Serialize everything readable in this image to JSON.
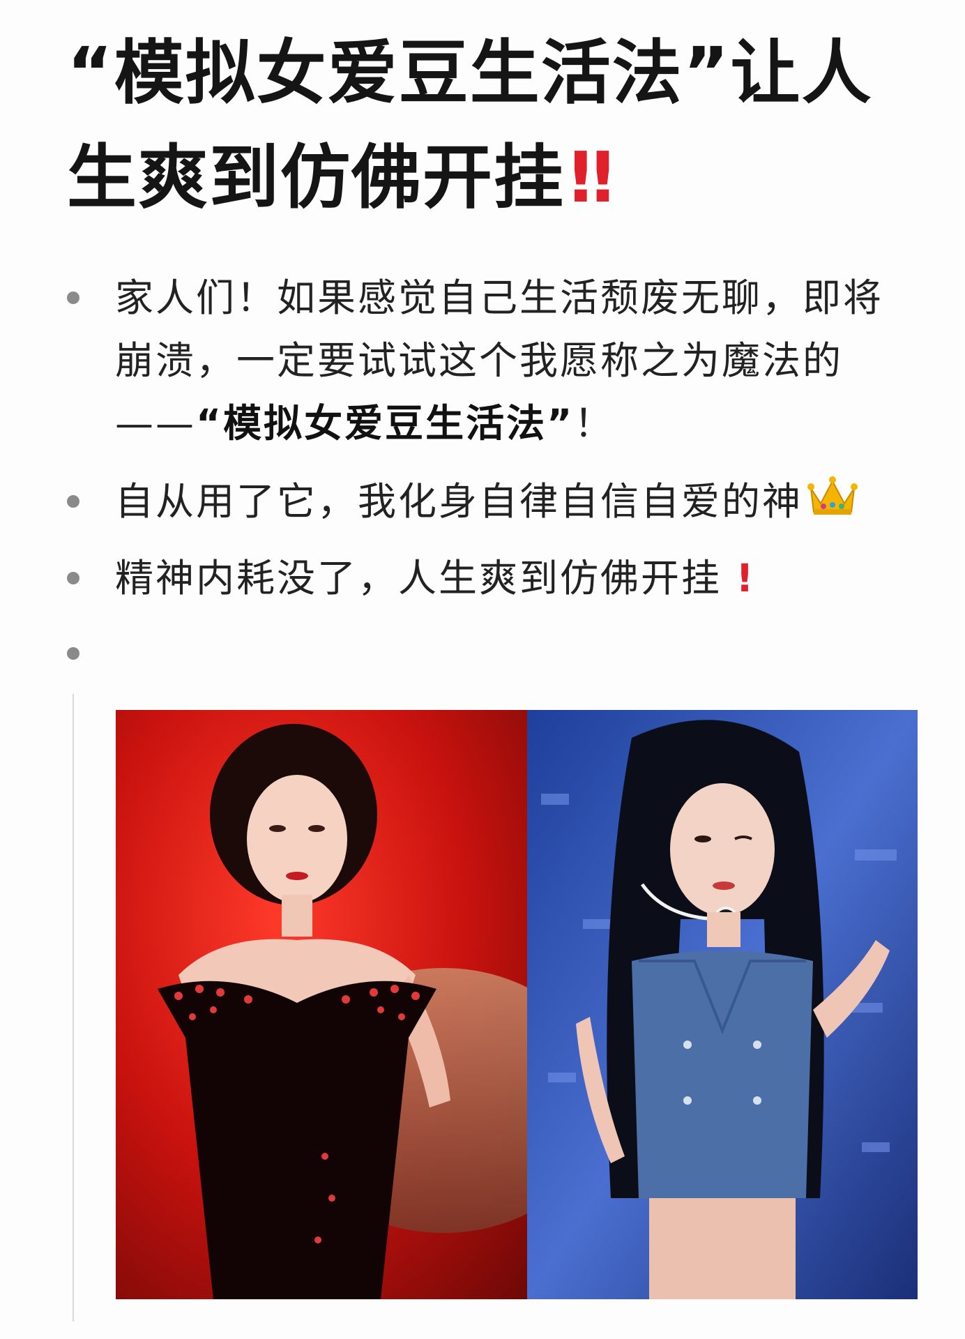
{
  "title": {
    "text": "“模拟女爱豆生活法”让人生爽到仿佛开挂",
    "marks": "!!"
  },
  "bullets": [
    {
      "line1": "家人们！如果感觉自己生活颓废无聊，即将",
      "line2": "崩溃，一定要试试这个我愿称之为魔法的",
      "line3_prefix": "——",
      "line3_bold": "“模拟女爱豆生活法”",
      "line3_suffix": "！"
    },
    {
      "text": "自从用了它，我化身自律自信自爱的神",
      "icon": "crown-icon"
    },
    {
      "text": "精神内耗没了，人生爽到仿佛开挂",
      "mark": "!"
    },
    {
      "text": ""
    }
  ],
  "images": [
    {
      "subject": "woman-in-black-sequin-dress-red-background",
      "icon": "photo-left"
    },
    {
      "subject": "woman-in-denim-vest-with-headset-mic-stage",
      "icon": "photo-right"
    }
  ],
  "colors": {
    "accent_red": "#e0202a",
    "text": "#1f1f1f",
    "bullet": "#8a8a8a"
  }
}
